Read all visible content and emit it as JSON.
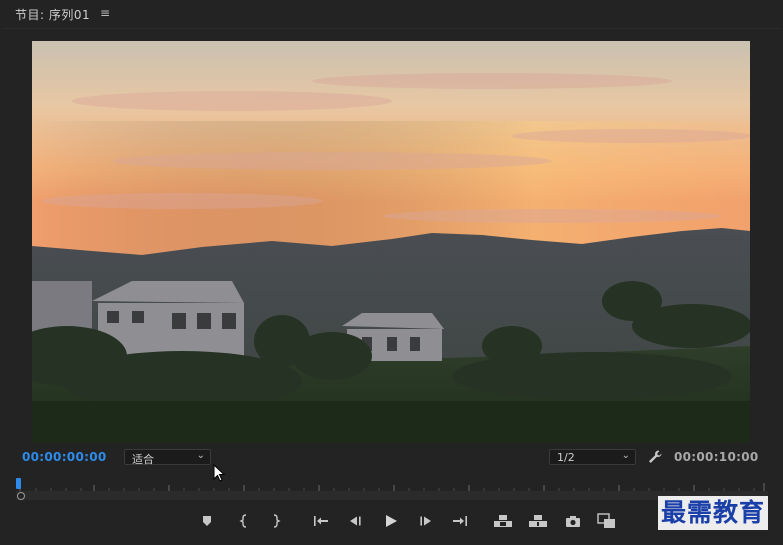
{
  "panel": {
    "title": "节目: 序列01",
    "menu_glyph": "≡"
  },
  "viewer": {
    "content_description_icon": "video-frame"
  },
  "transport": {
    "current_timecode": "00:00:00:00",
    "duration_timecode": "00:00:10:00",
    "zoom_select": {
      "selected": "适合"
    },
    "resolution_select": {
      "selected": "1/2"
    },
    "playhead_position": 0
  },
  "controls": [
    {
      "name": "add-marker-button",
      "icon": "marker-icon"
    },
    {
      "name": "mark-in-button",
      "icon": "mark-in-icon"
    },
    {
      "name": "mark-out-button",
      "icon": "mark-out-icon"
    },
    {
      "name": "go-to-in-button",
      "icon": "go-to-in-icon"
    },
    {
      "name": "step-back-button",
      "icon": "step-back-icon"
    },
    {
      "name": "play-button",
      "icon": "play-icon"
    },
    {
      "name": "step-forward-button",
      "icon": "step-forward-icon"
    },
    {
      "name": "go-to-out-button",
      "icon": "go-to-out-icon"
    },
    {
      "name": "lift-button",
      "icon": "lift-icon"
    },
    {
      "name": "extract-button",
      "icon": "extract-icon"
    },
    {
      "name": "export-frame-button",
      "icon": "camera-icon"
    },
    {
      "name": "compare-view-button",
      "icon": "compare-icon"
    }
  ],
  "watermark": {
    "text": "最需教育"
  },
  "colors": {
    "background": "#232323",
    "timecode_active": "#2d8ceb",
    "text": "#b9b9b9"
  }
}
